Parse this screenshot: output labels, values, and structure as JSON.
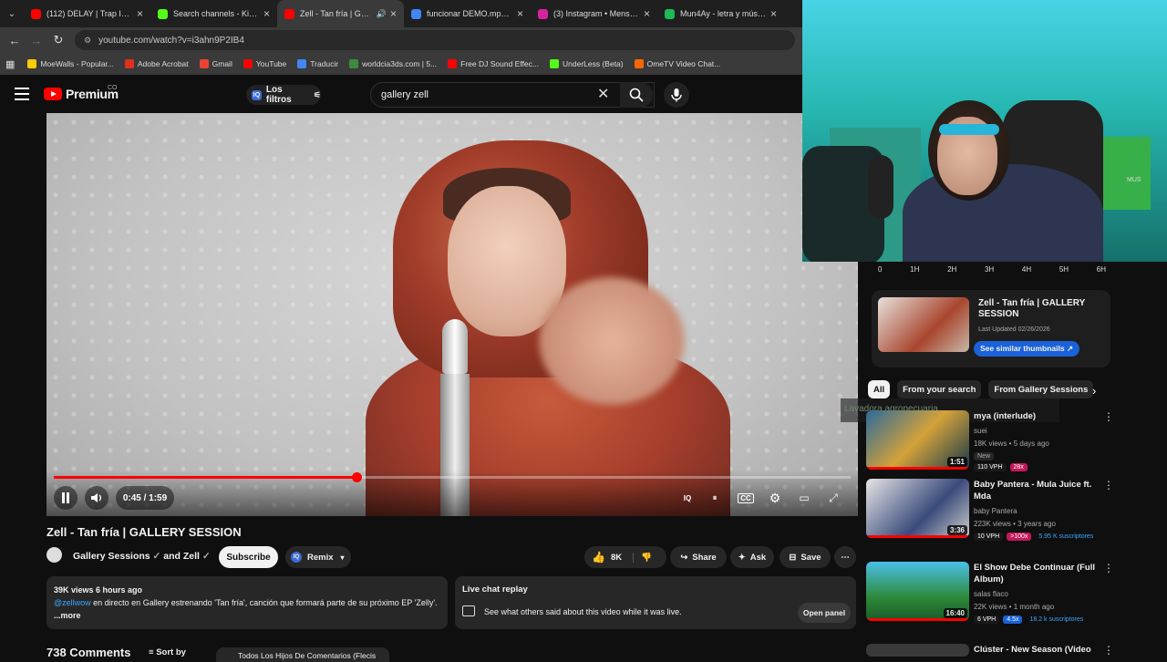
{
  "browser": {
    "tabs": [
      {
        "title": "(112) DELAY | Trap Instrum",
        "color": "#ff0000"
      },
      {
        "title": "Search channels - Kick Str",
        "color": "#53fc18"
      },
      {
        "title": "Zell - Tan fría | GALLE",
        "color": "#ff0000"
      },
      {
        "title": "funcionar DEMO.mp3 - G",
        "color": "#4285f4"
      },
      {
        "title": "(3) Instagram • Mensajes",
        "color": "#d6249f"
      },
      {
        "title": "Mun4Ay - letra y música d",
        "color": "#1db954"
      }
    ],
    "url": "youtube.com/watch?v=i3ahn9P2IB4",
    "bookmarks": [
      {
        "label": "MoeWalls - Popular...",
        "color": "#ffcc00"
      },
      {
        "label": "Adobe Acrobat",
        "color": "#e0301e"
      },
      {
        "label": "Gmail",
        "color": "#ea4335"
      },
      {
        "label": "YouTube",
        "color": "#ff0000"
      },
      {
        "label": "Traducir",
        "color": "#4285f4"
      },
      {
        "label": "worldcia3ds.com | 5...",
        "color": "#3d8b3d"
      },
      {
        "label": "Free DJ Sound Effec...",
        "color": "#ff0000"
      },
      {
        "label": "UnderLess (Beta)",
        "color": "#53fc18"
      },
      {
        "label": "OmeTV Video Chat...",
        "color": "#ff6600"
      }
    ]
  },
  "youtube": {
    "logo_text": "Premium",
    "country": "CO",
    "filters_label": "Los filtros",
    "search_value": "gallery zell"
  },
  "player": {
    "time": "0:45 / 1:59",
    "progress": 0.38
  },
  "video": {
    "title": "Zell - Tan fría | GALLERY SESSION",
    "channel": "Gallery Sessions",
    "and": "and Zell",
    "subscribe": "Subscribe",
    "remix": "Remix",
    "likes": "8K",
    "share": "Share",
    "ask": "Ask",
    "save": "Save",
    "views_time": "39K views  6 hours ago",
    "mention": "@zellwow",
    "description": " en directo en Gallery estrenando 'Tan fría', canción que formará parte de su próximo EP 'Zelly'.",
    "more": "...more",
    "livechat_title": "Live chat replay",
    "livechat_desc": "See what others said about this video while it was live.",
    "open_panel": "Open panel",
    "comments_count": "738 Comments",
    "sort_by": "Sort by",
    "comment_preview": "Todos Los Hijos De Comentarios (Flecis"
  },
  "sidebar": {
    "hours": [
      "0",
      "1H",
      "2H",
      "3H",
      "4H",
      "5H",
      "6H"
    ],
    "card_title": "Zell - Tan fría | GALLERY SESSION",
    "card_updated": "Last Updated 02/26/2026",
    "card_button": "See similar thumbnails ↗",
    "chips": [
      "All",
      "From your search",
      "From Gallery Sessions"
    ],
    "overlay_text": "Lavadora agropecuaria",
    "recs": [
      {
        "title": "mya (interlude)",
        "channel": "suei",
        "meta": "18K views • 5 days ago",
        "badge": "New",
        "tags": [
          "110 VPH",
          "28x"
        ],
        "duration": "1:51"
      },
      {
        "title": "Baby Pantera - Mula Juice ft. Mda",
        "channel": "baby Pantera",
        "meta": "223K views • 3 years ago",
        "badge": "",
        "tags": [
          "10 VPH",
          ">100x",
          "5.95 K suscriptores"
        ],
        "duration": "3:36"
      },
      {
        "title": "El Show Debe Continuar (Full Album)",
        "channel": "salas flaco",
        "meta": "22K views • 1 month ago",
        "badge": "",
        "tags": [
          "6 VPH",
          "4.5x",
          "18.2 k suscriptores"
        ],
        "duration": "16:40"
      },
      {
        "title": "Clúster - New Season (Video",
        "channel": "",
        "meta": "",
        "badge": "",
        "tags": [],
        "duration": ""
      }
    ]
  },
  "webcam": {
    "label": "MUS"
  }
}
